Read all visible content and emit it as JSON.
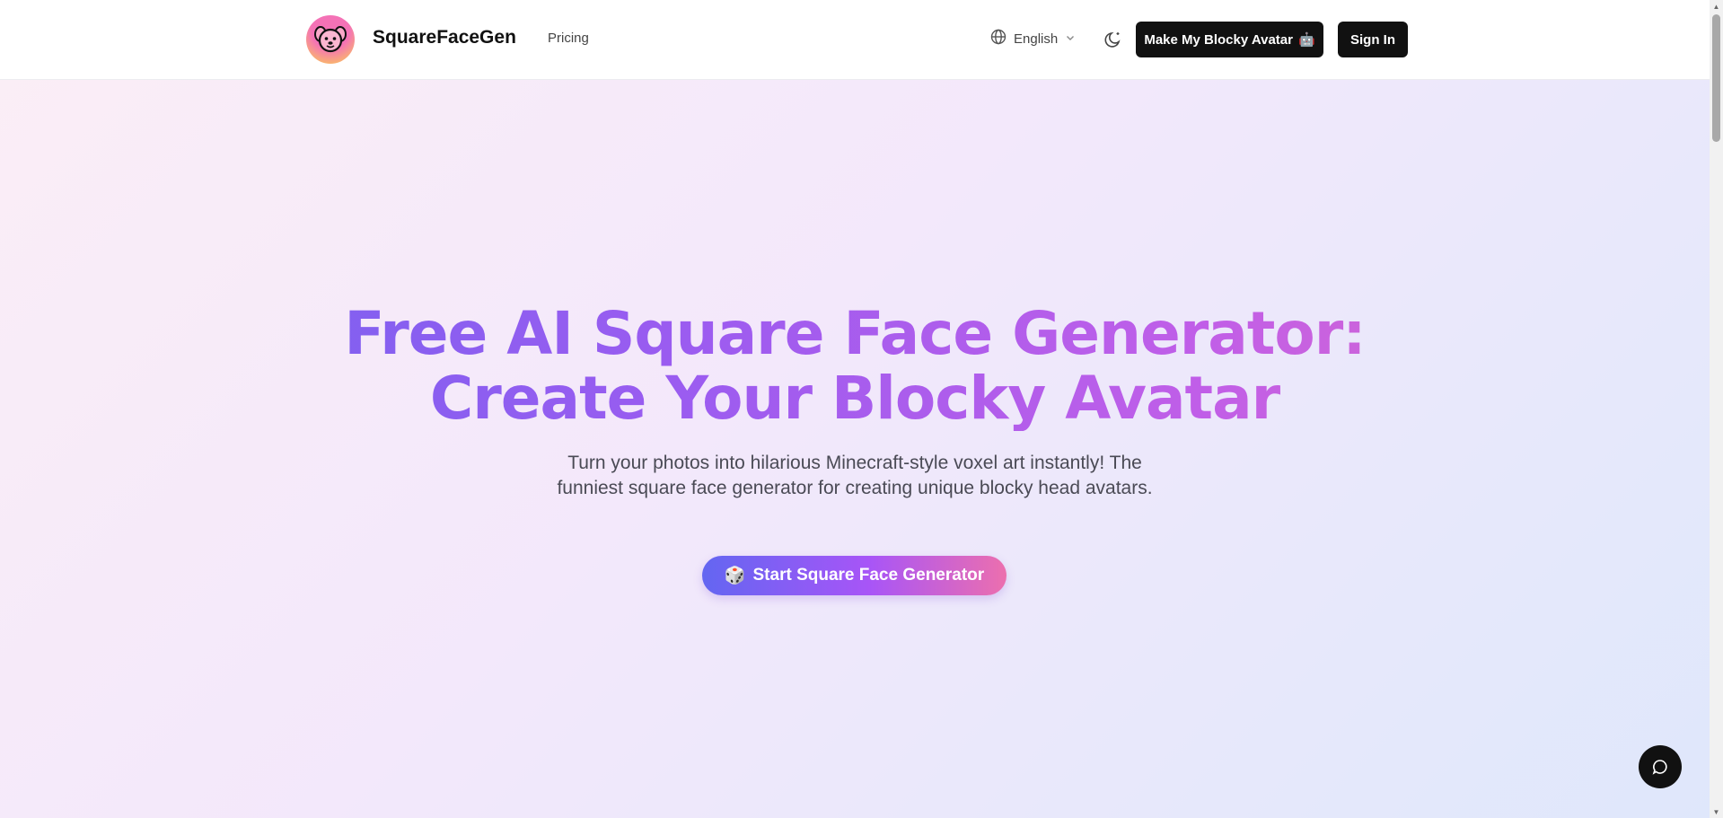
{
  "header": {
    "brand": "SquareFaceGen",
    "pricing": "Pricing",
    "language": "English",
    "make_button": "Make My Blocky Avatar",
    "make_button_emoji": "🤖",
    "sign_in": "Sign In"
  },
  "hero": {
    "title_line1": "Free AI Square Face Generator:",
    "title_line2": "Create Your Blocky Avatar",
    "subtitle": "Turn your photos into hilarious Minecraft-style voxel art instantly! The funniest square face generator for creating unique blocky head avatars.",
    "cta_label": "Start Square Face Generator",
    "cta_emoji": "🎲"
  },
  "icons": {
    "logo": "dog-face-logo",
    "language": "globe-icon",
    "dropdown": "chevron-down-icon",
    "theme": "moon-icon",
    "chat": "chat-bubble-icon"
  },
  "colors": {
    "accent_start": "#6366f1",
    "accent_mid": "#a855f7",
    "accent_end": "#ec6fae",
    "dark_button": "#111111"
  }
}
